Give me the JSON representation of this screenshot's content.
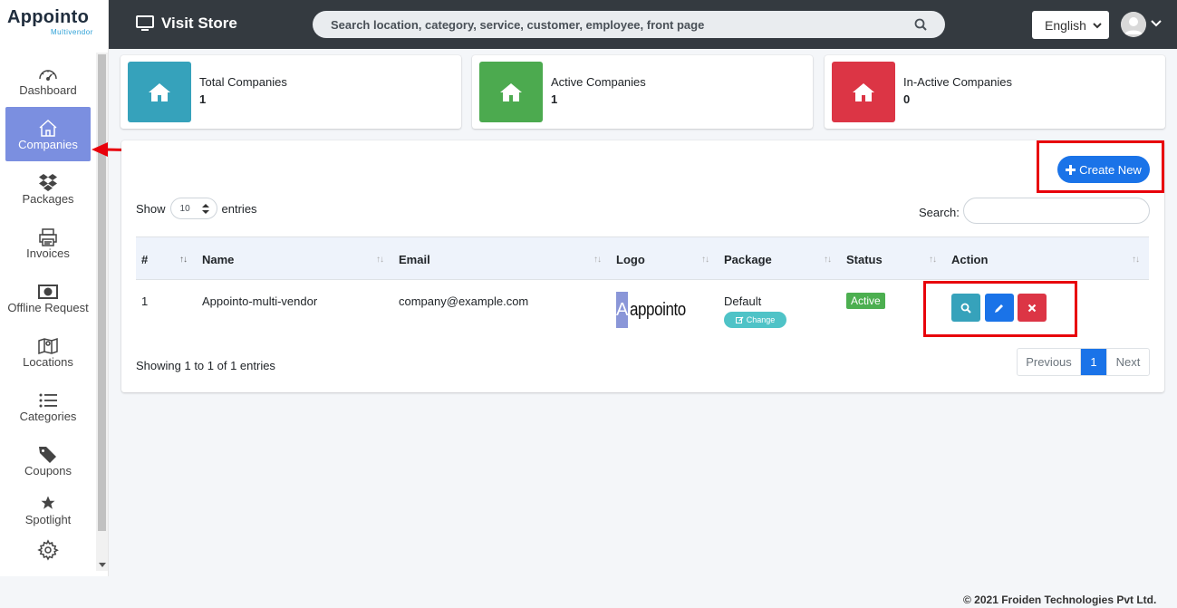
{
  "brand": {
    "name_part1": "App",
    "name_part2": "ointo",
    "subtitle": "Multivendor"
  },
  "sidebar": {
    "items": [
      {
        "label": "Dashboard",
        "icon": "gauge-icon"
      },
      {
        "label": "Companies",
        "icon": "home-icon",
        "active": true
      },
      {
        "label": "Packages",
        "icon": "dropbox-icon"
      },
      {
        "label": "Invoices",
        "icon": "printer-icon"
      },
      {
        "label": "Offline Request",
        "icon": "money-icon"
      },
      {
        "label": "Locations",
        "icon": "map-icon"
      },
      {
        "label": "Categories",
        "icon": "list-icon"
      },
      {
        "label": "Coupons",
        "icon": "tags-icon"
      },
      {
        "label": "Spotlight",
        "icon": "star-icon"
      },
      {
        "label": "",
        "icon": "gear-icon"
      }
    ]
  },
  "topbar": {
    "visit_store": "Visit Store",
    "search_placeholder": "Search location, category, service, customer, employee, front page",
    "language": "English"
  },
  "stats": [
    {
      "label": "Total Companies",
      "value": "1",
      "color": "#36a2bb"
    },
    {
      "label": "Active Companies",
      "value": "1",
      "color": "#4caa4f"
    },
    {
      "label": "In-Active Companies",
      "value": "0",
      "color": "#dc3545"
    }
  ],
  "main": {
    "create_label": "Create New",
    "show": "Show",
    "entries_value": "10",
    "entries": "entries",
    "search_label": "Search:",
    "columns": [
      "#",
      "Name",
      "Email",
      "Logo",
      "Package",
      "Status",
      "Action"
    ],
    "rows": [
      {
        "num": "1",
        "name": "Appointo-multi-vendor",
        "email": "company@example.com",
        "logo_mark": "A",
        "logo_word": "appointo",
        "package": "Default",
        "change": "Change",
        "status": "Active"
      }
    ],
    "showing": "Showing 1 to 1 of 1 entries",
    "pager": {
      "prev": "Previous",
      "page": "1",
      "next": "Next"
    }
  },
  "footer": "© 2021 Froiden Technologies Pvt Ltd.",
  "colors": {
    "primary": "#1a73e8",
    "info": "#36a2bb",
    "danger": "#dc3545",
    "success": "#4caf50",
    "sidebar_active": "#7b8fe0",
    "topbar": "#343a40",
    "annotation": "#e8000b"
  }
}
